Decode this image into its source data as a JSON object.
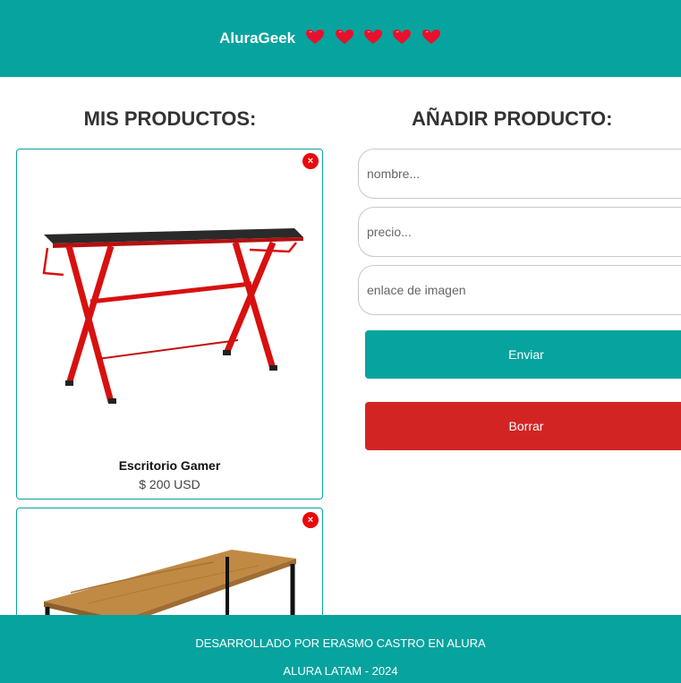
{
  "header": {
    "brand": "AluraGeek",
    "hearts": [
      "heart-icon",
      "heart-icon",
      "heart-icon",
      "heart-icon",
      "heart-icon"
    ]
  },
  "products_section": {
    "title": "MIS PRODUCTOS:"
  },
  "products": [
    {
      "name": "Escritorio Gamer",
      "price": "$ 200 USD",
      "delete_icon": "×",
      "image": "red-gaming-desk"
    },
    {
      "name": "",
      "price": "",
      "delete_icon": "×",
      "image": "wooden-table"
    }
  ],
  "form": {
    "title": "AÑADIR PRODUCTO:",
    "name_placeholder": "nombre...",
    "price_placeholder": "precio...",
    "image_placeholder": "enlace de imagen",
    "submit_label": "Enviar",
    "clear_label": "Borrar"
  },
  "footer": {
    "line1": "DESARROLLADO POR ERASMO CASTRO EN ALURA",
    "line2": "ALURA LATAM - 2024"
  },
  "colors": {
    "primary": "#07a39f",
    "danger": "#d32424",
    "close": "#e80a0a"
  }
}
